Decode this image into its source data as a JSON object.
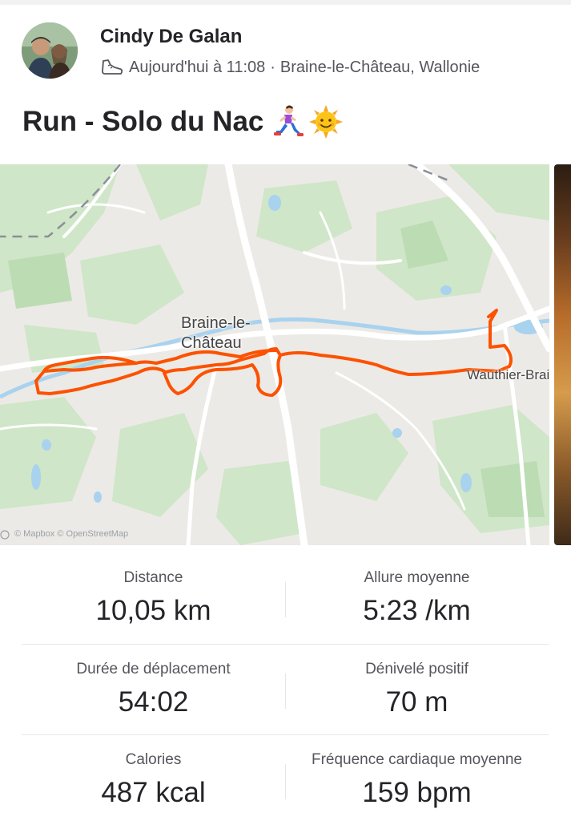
{
  "athlete": {
    "name": "Cindy De Galan",
    "date": "Aujourd'hui à 11:08",
    "separator": "·",
    "location": "Braine-le-Château, Wallonie",
    "sport_icon": "shoe-icon"
  },
  "activity": {
    "title": "Run - Solo du Nac",
    "emojis": [
      "woman-running-emoji",
      "sun-with-face-emoji"
    ]
  },
  "map": {
    "town_label_line1": "Braine-le-",
    "town_label_line2": "Château",
    "village_label": "Wauthier-Braine",
    "attribution": "© Mapbox © OpenStreetMap",
    "route_color": "#fc5200"
  },
  "stats": [
    {
      "label": "Distance",
      "value": "10,05 km"
    },
    {
      "label": "Allure moyenne",
      "value": "5:23 /km"
    },
    {
      "label": "Durée de déplacement",
      "value": "54:02"
    },
    {
      "label": "Dénivelé positif",
      "value": "70 m"
    },
    {
      "label": "Calories",
      "value": "487 kcal"
    },
    {
      "label": "Fréquence cardiaque moyenne",
      "value": "159 bpm"
    }
  ]
}
